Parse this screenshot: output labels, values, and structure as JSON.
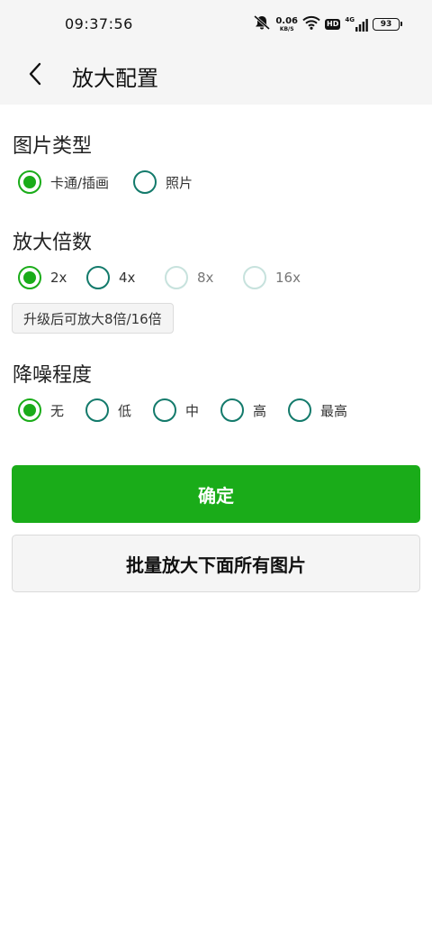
{
  "status_bar": {
    "time": "09:37:56",
    "net_speed_value": "0.06",
    "net_speed_unit": "KB/S",
    "hd_badge": "HD",
    "network_label": "4G",
    "battery_level": "93",
    "icons": [
      "mute-bell-icon",
      "wifi-icon",
      "hd-icon",
      "signal-4g-icon",
      "battery-icon"
    ]
  },
  "header": {
    "title": "放大配置",
    "back_icon": "chevron-left-icon"
  },
  "image_type": {
    "title": "图片类型",
    "options": [
      {
        "label": "卡通/插画",
        "checked": true,
        "enabled": true
      },
      {
        "label": "照片",
        "checked": false,
        "enabled": true
      }
    ]
  },
  "scale": {
    "title": "放大倍数",
    "options": [
      {
        "label": "2x",
        "checked": true,
        "enabled": true
      },
      {
        "label": "4x",
        "checked": false,
        "enabled": true
      },
      {
        "label": "8x",
        "checked": false,
        "enabled": false
      },
      {
        "label": "16x",
        "checked": false,
        "enabled": false
      }
    ],
    "upgrade_hint": "升级后可放大8倍/16倍"
  },
  "denoise": {
    "title": "降噪程度",
    "options": [
      {
        "label": "无",
        "checked": true,
        "enabled": true
      },
      {
        "label": "低",
        "checked": false,
        "enabled": true
      },
      {
        "label": "中",
        "checked": false,
        "enabled": true
      },
      {
        "label": "高",
        "checked": false,
        "enabled": true
      },
      {
        "label": "最高",
        "checked": false,
        "enabled": true
      }
    ]
  },
  "actions": {
    "confirm_label": "确定",
    "batch_label": "批量放大下面所有图片"
  },
  "colors": {
    "accent_green": "#1aac19",
    "radio_teal": "#137a6b",
    "radio_disabled": "#c7e2dd",
    "header_bg": "#f5f5f5"
  }
}
